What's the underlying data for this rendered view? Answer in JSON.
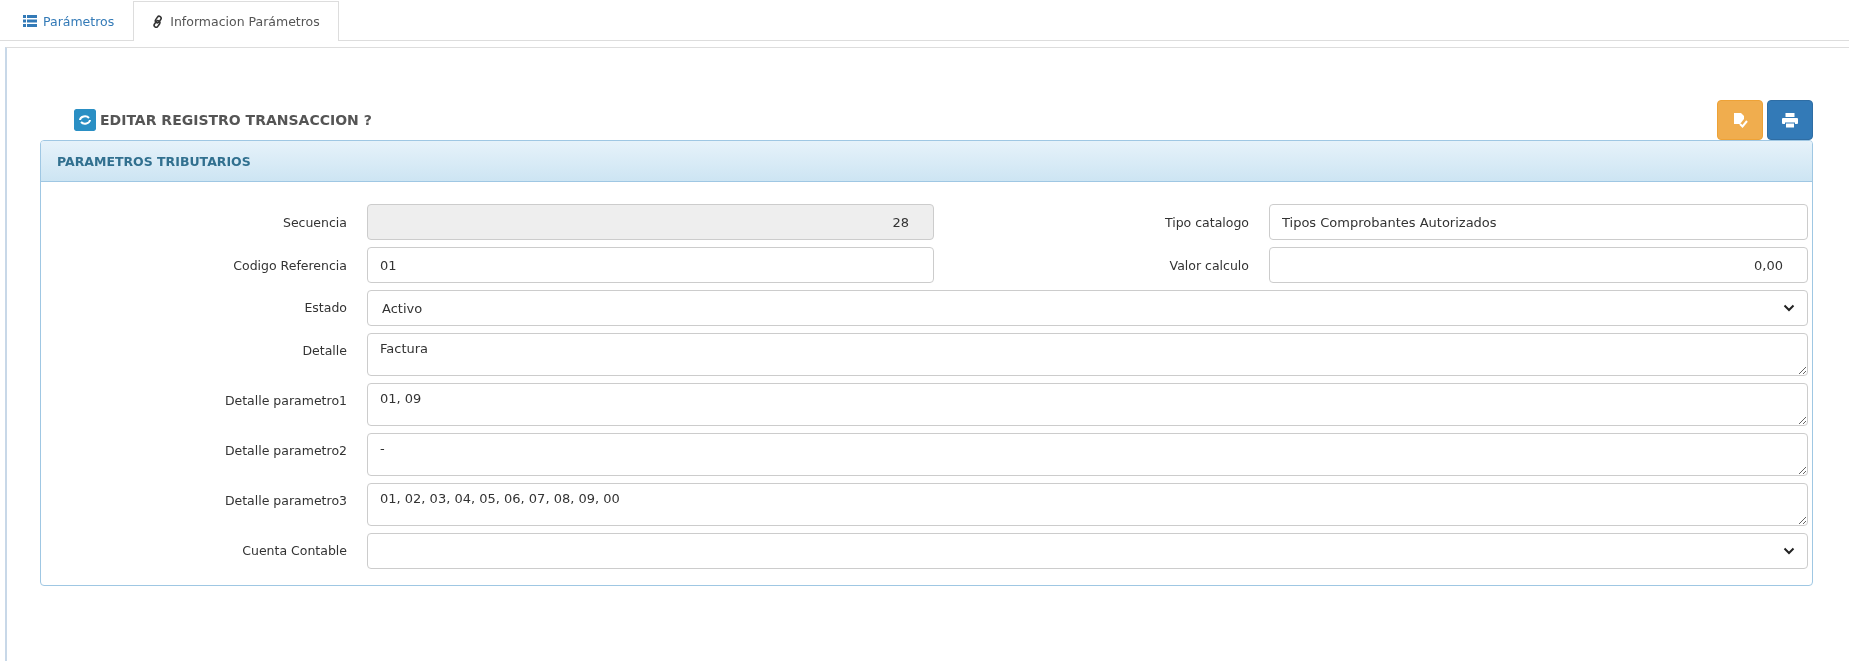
{
  "tabs": [
    {
      "label": "Parámetros",
      "selected": false
    },
    {
      "label": "Informacion Parámetros",
      "selected": true
    }
  ],
  "title": "EDITAR REGISTRO TRANSACCION ?",
  "panel": {
    "heading": "PARAMETROS TRIBUTARIOS",
    "paired_rows": [
      [
        {
          "label": "Secuencia",
          "value": "28",
          "kind": "number",
          "readonly": true
        },
        {
          "label": "Tipo catalogo",
          "value": "Tipos Comprobantes Autorizados",
          "kind": "input",
          "readonly": false
        }
      ],
      [
        {
          "label": "Codigo Referencia",
          "value": "01",
          "kind": "input",
          "readonly": false
        },
        {
          "label": "Valor calculo",
          "value": "0,00",
          "kind": "number",
          "readonly": false
        }
      ]
    ],
    "rows": [
      {
        "label": "Estado",
        "value": "Activo",
        "kind": "select"
      },
      {
        "label": "Detalle",
        "value": "Factura",
        "kind": "textarea"
      },
      {
        "label": "Detalle parametro1",
        "value": "01, 09",
        "kind": "textarea"
      },
      {
        "label": "Detalle parametro2",
        "value": "-",
        "kind": "textarea"
      },
      {
        "label": "Detalle parametro3",
        "value": "01, 02, 03, 04, 05, 06, 07, 08, 09, 00",
        "kind": "textarea"
      },
      {
        "label": "Cuenta Contable",
        "kind": "select"
      }
    ]
  }
}
